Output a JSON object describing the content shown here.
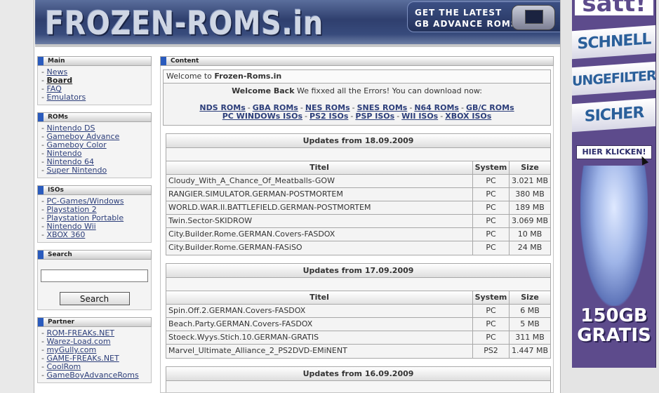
{
  "header": {
    "logo": "FROZEN-ROMS.in",
    "promo_line1": "GET THE LATEST",
    "promo_line2": "GB ADVANCE ROMS"
  },
  "sidebar": {
    "main": {
      "title": "Main",
      "items": [
        "News",
        "Board",
        "FAQ",
        "Emulators"
      ]
    },
    "roms": {
      "title": "ROMs",
      "items": [
        "Nintendo DS",
        "Gameboy Advance",
        "Gameboy Color",
        "Nintendo",
        "Nintendo 64",
        "Super Nintendo"
      ]
    },
    "isos": {
      "title": "ISOs",
      "items": [
        "PC-Games/Windows",
        "Playstation 2",
        "Playstation Portable",
        "Nintendo Wii",
        "XBOX 360"
      ]
    },
    "search": {
      "title": "Search",
      "button": "Search",
      "value": ""
    },
    "partner": {
      "title": "Partner",
      "items": [
        "ROM-FREAKs.NET",
        "Warez-Load.com",
        "myGully.com",
        "GAME-FREAKs.NET",
        "CoolRom",
        "GameBoyAdvanceRoms"
      ]
    }
  },
  "content": {
    "title": "Content",
    "welcome_prefix": "Welcome to ",
    "welcome_site": "Frozen-Roms.in",
    "welcome_back": "Welcome Back",
    "welcome_msg": " We fixxed all the Errors! You can download now:",
    "links_row1": [
      "NDS ROMs",
      "GBA ROMs",
      "NES ROMs",
      "SNES ROMs",
      "N64 ROMs",
      "GB/C ROMs"
    ],
    "links_row2": [
      "PC WINDOWs ISOs",
      "PS2 ISOs",
      "PSP ISOs",
      "WII ISOs",
      "XBOX ISOs"
    ],
    "sep": "-"
  },
  "table_headers": {
    "title": "Titel",
    "system": "System",
    "size": "Size"
  },
  "updates": [
    {
      "heading": "Updates from 18.09.2009",
      "rows": [
        {
          "title": "Cloudy_With_A_Chance_Of_Meatballs-GOW",
          "system": "PC",
          "size": "3.021 MB"
        },
        {
          "title": "RANGIER.SIMULATOR.GERMAN-POSTMORTEM",
          "system": "PC",
          "size": "380 MB"
        },
        {
          "title": "WORLD.WAR.II.BATTLEFIELD.GERMAN-POSTMORTEM",
          "system": "PC",
          "size": "189 MB"
        },
        {
          "title": "Twin.Sector-SKIDROW",
          "system": "PC",
          "size": "3.069 MB"
        },
        {
          "title": "City.Builder.Rome.GERMAN.Covers-FASDOX",
          "system": "PC",
          "size": "10 MB"
        },
        {
          "title": "City.Builder.Rome.GERMAN-FASiSO",
          "system": "PC",
          "size": "24 MB"
        }
      ]
    },
    {
      "heading": "Updates from 17.09.2009",
      "rows": [
        {
          "title": "Spin.Off.2.GERMAN.Covers-FASDOX",
          "system": "PC",
          "size": "6 MB"
        },
        {
          "title": "Beach.Party.GERMAN.Covers-FASDOX",
          "system": "PC",
          "size": "5 MB"
        },
        {
          "title": "Stoeck.Wyys.Stich.10.GERMAN-GRATIS",
          "system": "PC",
          "size": "311 MB"
        },
        {
          "title": "Marvel_Ultimate_Alliance_2_PS2DVD-EMiNENT",
          "system": "PS2",
          "size": "1.447 MB"
        }
      ]
    },
    {
      "heading": "Updates from 16.09.2009",
      "rows": []
    }
  ],
  "ad": {
    "top": "satt!",
    "bands": [
      "SCHNELL",
      "UNGEFILTERT",
      "SICHER"
    ],
    "cta": "HIER KLICKEN!",
    "bottom_line1": "150GB",
    "bottom_line2": "GRATIS"
  },
  "colors": {
    "accent": "#2a5bbd",
    "link": "#2c3e7a",
    "ad_bg": "#5d4b8c"
  }
}
